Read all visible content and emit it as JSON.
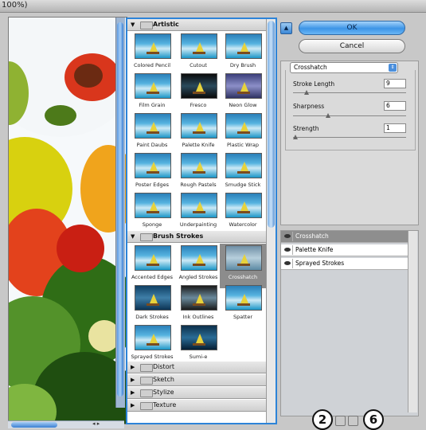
{
  "window": {
    "title": "100%)"
  },
  "gallery": {
    "groups": [
      {
        "name": "Artistic",
        "expanded": true,
        "filters": [
          "Colored Pencil",
          "Cutout",
          "Dry Brush",
          "Film Grain",
          "Fresco",
          "Neon Glow",
          "Paint Daubs",
          "Palette Knife",
          "Plastic Wrap",
          "Poster Edges",
          "Rough Pastels",
          "Smudge Stick",
          "Sponge",
          "Underpainting",
          "Watercolor"
        ]
      },
      {
        "name": "Brush Strokes",
        "expanded": true,
        "filters": [
          "Accented Edges",
          "Angled Strokes",
          "Crosshatch",
          "Dark Strokes",
          "Ink Outlines",
          "Spatter",
          "Sprayed Strokes",
          "Sumi-e"
        ],
        "selected": "Crosshatch"
      },
      {
        "name": "Distort",
        "expanded": false
      },
      {
        "name": "Sketch",
        "expanded": false
      },
      {
        "name": "Stylize",
        "expanded": false
      },
      {
        "name": "Texture",
        "expanded": false
      }
    ]
  },
  "buttons": {
    "ok": "OK",
    "cancel": "Cancel",
    "collapse_icon": "up-arrow-icon"
  },
  "settings": {
    "filter_select": "Crosshatch",
    "params": [
      {
        "label": "Stroke Length",
        "value": "9",
        "level": 0.1
      },
      {
        "label": "Sharpness",
        "value": "6",
        "level": 0.3
      },
      {
        "label": "Strength",
        "value": "1",
        "level": 0.0
      }
    ]
  },
  "layers": [
    {
      "name": "Crosshatch",
      "active": true
    },
    {
      "name": "Palette Knife",
      "active": false
    },
    {
      "name": "Sprayed Strokes",
      "active": false
    }
  ],
  "annotations": {
    "left": "2",
    "right": "6"
  }
}
